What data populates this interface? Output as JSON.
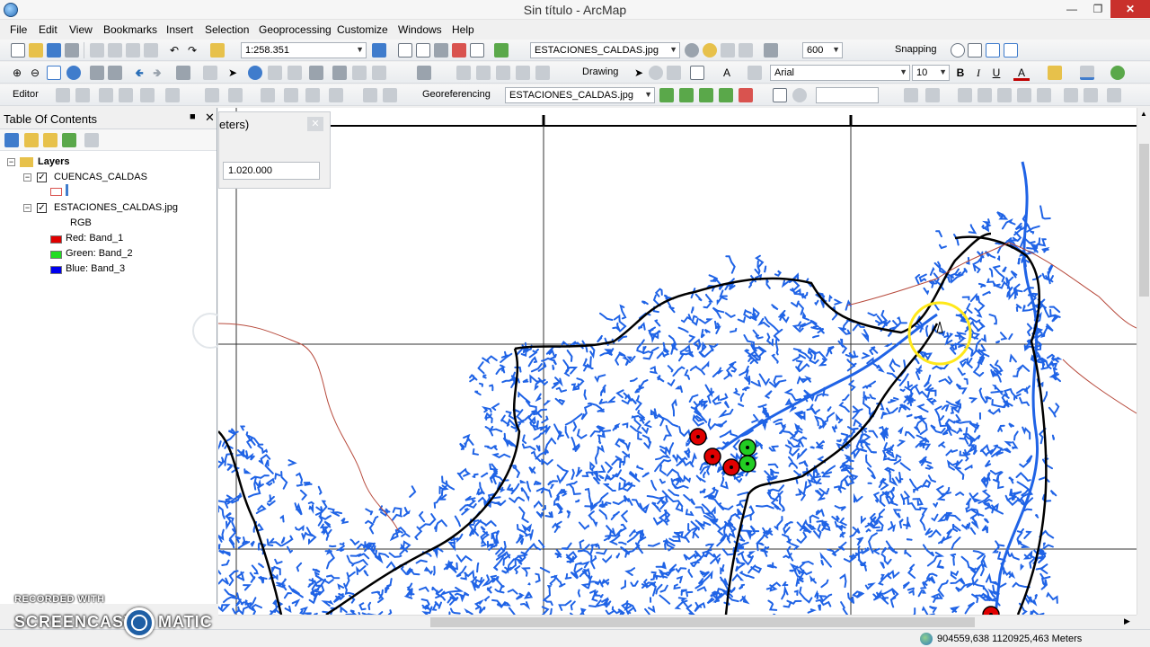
{
  "window": {
    "title": "Sin título - ArcMap"
  },
  "menu": [
    "File",
    "Edit",
    "View",
    "Bookmarks",
    "Insert",
    "Selection",
    "Geoprocessing",
    "Customize",
    "Windows",
    "Help"
  ],
  "toolbar1": {
    "scale": "1:258.351",
    "layer": "ESTACIONES_CALDAS.jpg",
    "resolution": "600",
    "snapping_label": "Snapping"
  },
  "toolbar2": {
    "drawing_label": "Drawing",
    "font_name": "Arial",
    "font_size": "10",
    "bold": "B",
    "italic": "I",
    "underline": "U",
    "font_color": "A"
  },
  "toolbar3": {
    "editor_label": "Editor",
    "georef_label": "Georeferencing",
    "georef_layer": "ESTACIONES_CALDAS.jpg",
    "input_value": ""
  },
  "toc": {
    "title": "Table Of Contents",
    "root": "Layers",
    "layers": [
      {
        "name": "CUENCAS_CALDAS",
        "checked": true
      },
      {
        "name": "ESTACIONES_CALDAS.jpg",
        "checked": true
      }
    ],
    "rgb_label": "RGB",
    "bands": [
      {
        "label": "Red:",
        "band": "Band_1",
        "color": "#e00000"
      },
      {
        "label": "Green:",
        "band": "Band_2",
        "color": "#22dd22"
      },
      {
        "label": "Blue:",
        "band": "Band_3",
        "color": "#0000ee"
      }
    ]
  },
  "float_panel": {
    "title": "eters)",
    "value": "1.020.000"
  },
  "map": {
    "river_color": "#1f63e6",
    "boundary_color": "#000000",
    "dept_boundary_color": "#b74a3c",
    "station_colors": [
      "#e00000",
      "#22cc22"
    ]
  },
  "status": {
    "coords": "904559,638  1120925,463 Meters"
  },
  "watermark": {
    "small": "RECORDED WITH",
    "left": "SCREENCAST",
    "right": "MATIC"
  }
}
